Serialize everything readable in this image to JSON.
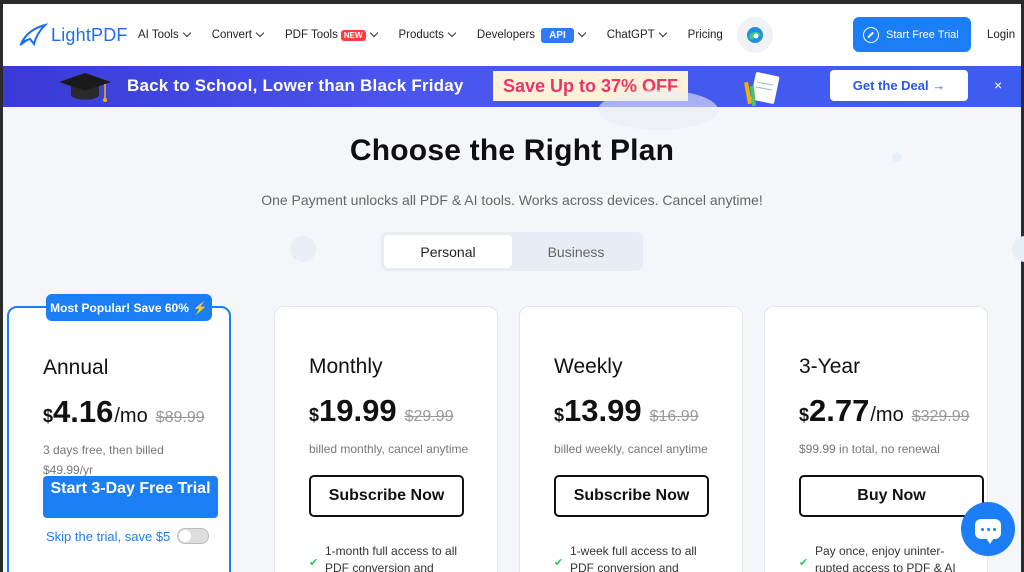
{
  "header": {
    "logo_text": "LightPDF",
    "nav": [
      {
        "label": "AI Tools"
      },
      {
        "label": "Convert"
      },
      {
        "label": "PDF Tools",
        "badge": "NEW"
      },
      {
        "label": "Products"
      },
      {
        "label": "Developers",
        "badge": "API"
      },
      {
        "label": "ChatGPT"
      },
      {
        "label": "Pricing"
      }
    ],
    "cta_label": "Start Free Trial",
    "login_label": "Login"
  },
  "banner": {
    "title": "Back to School, Lower than Black Friday",
    "highlight": "Save Up to 37% OFF",
    "deal_label": "Get the Deal →",
    "close_label": "×"
  },
  "main": {
    "title": "Choose the Right Plan",
    "subtitle": "One Payment unlocks all PDF & AI tools. Works across devices. Cancel anytime!",
    "tabs": [
      "Personal",
      "Business"
    ],
    "active_tab": "Personal"
  },
  "plans": [
    {
      "tag": "Most Popular! Save 60%",
      "name": "Annual",
      "currency": "$",
      "price": "4.16",
      "period": "/mo",
      "old_price": "$89.99",
      "note": "3 days free, then billed $49.99/yr",
      "button": "Start 3-Day Free Trial",
      "skip_label": "Skip the trial, save $5",
      "feature": ""
    },
    {
      "name": "Monthly",
      "currency": "$",
      "price": "19.99",
      "period": "",
      "old_price": "$29.99",
      "note": "billed monthly, cancel anytime",
      "button": "Subscribe Now",
      "feature": "1-month full access to all PDF conversion and"
    },
    {
      "name": "Weekly",
      "currency": "$",
      "price": "13.99",
      "period": "",
      "old_price": "$16.99",
      "note": "billed weekly, cancel anytime",
      "button": "Subscribe Now",
      "feature": "1-week full access to all PDF conversion and"
    },
    {
      "name": "3-Year",
      "currency": "$",
      "price": "2.77",
      "period": "/mo",
      "old_price": "$329.99",
      "note": "$99.99 in total, no renewal",
      "button": "Buy Now",
      "feature": "Pay once, enjoy uninter-rupted access to PDF & AI"
    }
  ],
  "colors": {
    "brand_blue": "#1b7ef5",
    "banner_bg": "#4352ea",
    "highlight_pink": "#e8356c",
    "check_green": "#2ec45a"
  },
  "icons": [
    "logo-icon",
    "edge-browser-icon",
    "trial-icon",
    "graduation-cap-icon",
    "notebook-icon",
    "close-icon",
    "lightning-icon",
    "check-icon",
    "chat-icon"
  ]
}
